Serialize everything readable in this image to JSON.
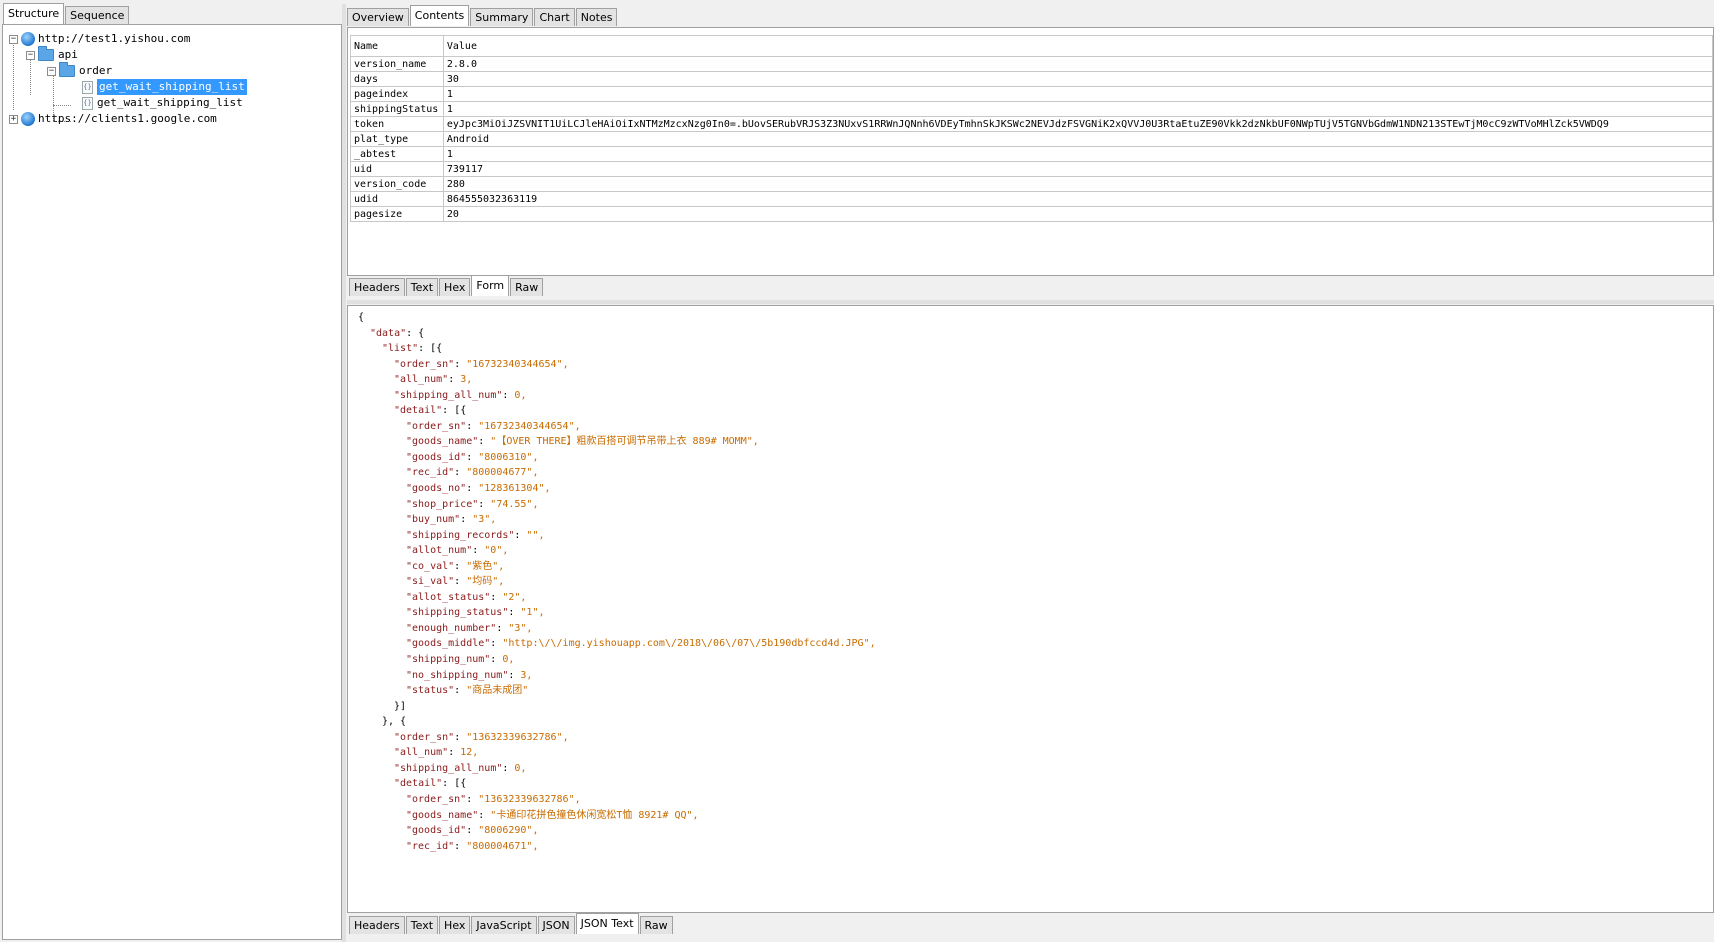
{
  "left_tabs": [
    "Structure",
    "Sequence"
  ],
  "tree": {
    "root1": "http://test1.yishou.com",
    "api": "api",
    "order": "order",
    "item1": "get_wait_shipping_list",
    "item2": "get_wait_shipping_list",
    "root2": "https://clients1.google.com"
  },
  "top_tabs": [
    "Overview",
    "Contents",
    "Summary",
    "Chart",
    "Notes"
  ],
  "table": {
    "headers": [
      "Name",
      "Value"
    ],
    "rows": [
      [
        "version_name",
        "2.8.0"
      ],
      [
        "days",
        "30"
      ],
      [
        "pageindex",
        "1"
      ],
      [
        "shippingStatus",
        "1"
      ],
      [
        "token",
        "eyJpc3MiOiJZSVNIT1UiLCJleHAiOiIxNTMzMzcxNzg0In0=.bUovSERubVRJS3Z3NUxvS1RRWnJQNnh6VDEyTmhnSkJKSWc2NEVJdzFSVGNiK2xQVVJ0U3RtaEtuZE90Vkk2dzNkbUF0NWpTUjV5TGNVbGdmW1NDN213STEwTjM0cC9zWTVoMHlZck5VWDQ9"
      ],
      [
        "plat_type",
        "Android"
      ],
      [
        "_abtest",
        "1"
      ],
      [
        "uid",
        "739117"
      ],
      [
        "version_code",
        "280"
      ],
      [
        "udid",
        "864555032363119"
      ],
      [
        "pagesize",
        "20"
      ]
    ]
  },
  "request_tabs": [
    "Headers",
    "Text",
    "Hex",
    "Form",
    "Raw"
  ],
  "response_tabs": [
    "Headers",
    "Text",
    "Hex",
    "JavaScript",
    "JSON",
    "JSON Text",
    "Raw"
  ],
  "json_lines": [
    [
      0,
      "",
      "{",
      ""
    ],
    [
      1,
      "\"data\"",
      ": {",
      ""
    ],
    [
      2,
      "\"list\"",
      ": [{",
      ""
    ],
    [
      3,
      "\"order_sn\"",
      ": ",
      "\"16732340344654\","
    ],
    [
      3,
      "\"all_num\"",
      ": ",
      "3,"
    ],
    [
      3,
      "\"shipping_all_num\"",
      ": ",
      "0,"
    ],
    [
      3,
      "\"detail\"",
      ": [{",
      ""
    ],
    [
      4,
      "\"order_sn\"",
      ": ",
      "\"16732340344654\","
    ],
    [
      4,
      "\"goods_name\"",
      ": ",
      "\"【OVER THERE】粗款百搭可调节吊带上衣 889# MOMM\","
    ],
    [
      4,
      "\"goods_id\"",
      ": ",
      "\"8006310\","
    ],
    [
      4,
      "\"rec_id\"",
      ": ",
      "\"800004677\","
    ],
    [
      4,
      "\"goods_no\"",
      ": ",
      "\"128361304\","
    ],
    [
      4,
      "\"shop_price\"",
      ": ",
      "\"74.55\","
    ],
    [
      4,
      "\"buy_num\"",
      ": ",
      "\"3\","
    ],
    [
      4,
      "\"shipping_records\"",
      ": ",
      "\"\","
    ],
    [
      4,
      "\"allot_num\"",
      ": ",
      "\"0\","
    ],
    [
      4,
      "\"co_val\"",
      ": ",
      "\"紫色\","
    ],
    [
      4,
      "\"si_val\"",
      ": ",
      "\"均码\","
    ],
    [
      4,
      "\"allot_status\"",
      ": ",
      "\"2\","
    ],
    [
      4,
      "\"shipping_status\"",
      ": ",
      "\"1\","
    ],
    [
      4,
      "\"enough_number\"",
      ": ",
      "\"3\","
    ],
    [
      4,
      "\"goods_middle\"",
      ": ",
      "\"http:\\/\\/img.yishouapp.com\\/2018\\/06\\/07\\/5b190dbfccd4d.JPG\","
    ],
    [
      4,
      "\"shipping_num\"",
      ": ",
      "0,"
    ],
    [
      4,
      "\"no_shipping_num\"",
      ": ",
      "3,"
    ],
    [
      4,
      "\"status\"",
      ": ",
      "\"商品未成团\""
    ],
    [
      3,
      "",
      "}]",
      ""
    ],
    [
      2,
      "",
      "}, {",
      ""
    ],
    [
      3,
      "\"order_sn\"",
      ": ",
      "\"13632339632786\","
    ],
    [
      3,
      "\"all_num\"",
      ": ",
      "12,"
    ],
    [
      3,
      "\"shipping_all_num\"",
      ": ",
      "0,"
    ],
    [
      3,
      "\"detail\"",
      ": [{",
      ""
    ],
    [
      4,
      "\"order_sn\"",
      ": ",
      "\"13632339632786\","
    ],
    [
      4,
      "\"goods_name\"",
      ": ",
      "\"卡通印花拼色撞色休闲宽松T恤 8921# QQ\","
    ],
    [
      4,
      "\"goods_id\"",
      ": ",
      "\"8006290\","
    ],
    [
      4,
      "\"rec_id\"",
      ": ",
      "\"800004671\","
    ]
  ]
}
